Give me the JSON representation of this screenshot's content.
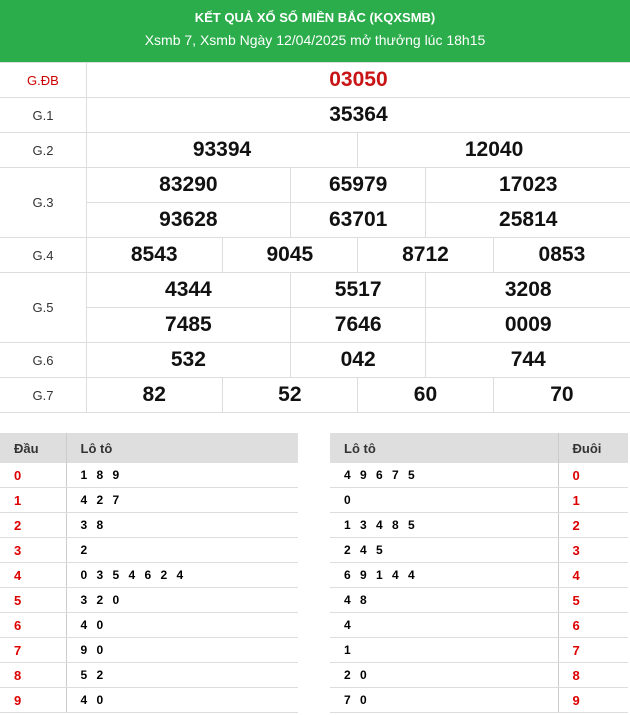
{
  "header": {
    "title": "KẾT QUẢ XỔ SỐ MIỀN BẮC (KQXSMB)",
    "subtitle": "Xsmb 7, Xsmb Ngày 12/04/2025 mở thưởng lúc 18h15"
  },
  "prizes": {
    "gdb": {
      "label": "G.ĐB",
      "numbers": [
        "03050"
      ]
    },
    "g1": {
      "label": "G.1",
      "numbers": [
        "35364"
      ]
    },
    "g2": {
      "label": "G.2",
      "numbers": [
        "93394",
        "12040"
      ]
    },
    "g3": {
      "label": "G.3",
      "numbers": [
        "83290",
        "65979",
        "17023",
        "93628",
        "63701",
        "25814"
      ]
    },
    "g4": {
      "label": "G.4",
      "numbers": [
        "8543",
        "9045",
        "8712",
        "0853"
      ]
    },
    "g5": {
      "label": "G.5",
      "numbers": [
        "4344",
        "5517",
        "3208",
        "7485",
        "7646",
        "0009"
      ]
    },
    "g6": {
      "label": "G.6",
      "numbers": [
        "532",
        "042",
        "744"
      ]
    },
    "g7": {
      "label": "G.7",
      "numbers": [
        "82",
        "52",
        "60",
        "70"
      ]
    }
  },
  "loto_dau": {
    "col_head": "Đầu",
    "col_loto": "Lô tô",
    "rows": [
      {
        "head": "0",
        "loto": "1 8 9"
      },
      {
        "head": "1",
        "loto": "4 2 7"
      },
      {
        "head": "2",
        "loto": "3 8"
      },
      {
        "head": "3",
        "loto": "2"
      },
      {
        "head": "4",
        "loto": "0 3 5 4 6 2 4"
      },
      {
        "head": "5",
        "loto": "3 2 0"
      },
      {
        "head": "6",
        "loto": "4 0"
      },
      {
        "head": "7",
        "loto": "9 0"
      },
      {
        "head": "8",
        "loto": "5 2"
      },
      {
        "head": "9",
        "loto": "4 0"
      }
    ]
  },
  "loto_duoi": {
    "col_loto": "Lô tô",
    "col_tail": "Đuôi",
    "rows": [
      {
        "loto": "4 9 6 7 5",
        "tail": "0"
      },
      {
        "loto": "0",
        "tail": "1"
      },
      {
        "loto": "1 3 4 8 5",
        "tail": "2"
      },
      {
        "loto": "2 4 5",
        "tail": "3"
      },
      {
        "loto": "6 9 1 4 4",
        "tail": "4"
      },
      {
        "loto": "4 8",
        "tail": "5"
      },
      {
        "loto": "4",
        "tail": "6"
      },
      {
        "loto": "1",
        "tail": "7"
      },
      {
        "loto": "2 0",
        "tail": "8"
      },
      {
        "loto": "7 0",
        "tail": "9"
      }
    ]
  }
}
